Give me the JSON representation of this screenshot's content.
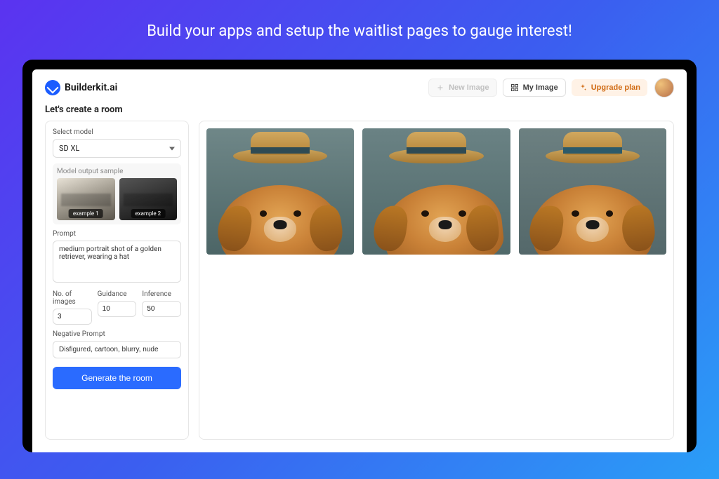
{
  "banner": "Build your apps and setup the waitlist pages to gauge interest!",
  "brand": "Builderkit.ai",
  "topbar": {
    "new_image": "New Image",
    "my_image": "My Image",
    "upgrade": "Upgrade plan"
  },
  "page_title": "Let's create a room",
  "sidebar": {
    "select_model_label": "Select model",
    "model_value": "SD XL",
    "sample_label": "Model output sample",
    "examples": [
      "example 1",
      "example 2"
    ],
    "prompt_label": "Prompt",
    "prompt_value": "medium portrait shot of a golden retriever, wearing a hat",
    "num_images_label": "No. of images",
    "num_images_value": "3",
    "guidance_label": "Guidance",
    "guidance_value": "10",
    "inference_label": "Inference",
    "inference_value": "50",
    "neg_prompt_label": "Negative Prompt",
    "neg_prompt_value": "Disfigured, cartoon, blurry, nude",
    "generate_label": "Generate the room"
  }
}
